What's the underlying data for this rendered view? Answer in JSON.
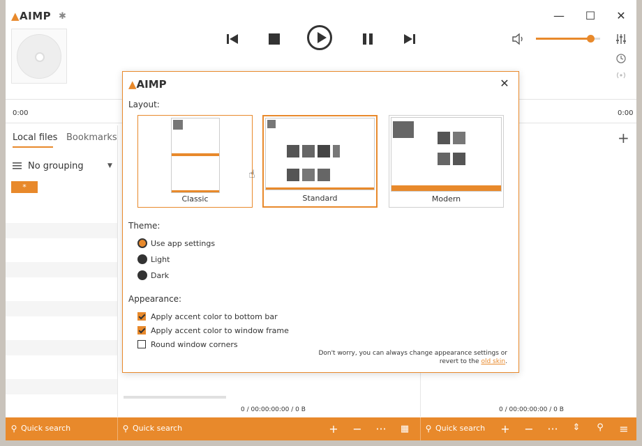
{
  "app": {
    "logo": "AIMP"
  },
  "player": {
    "time_left": "0:00",
    "time_right": "0:00",
    "volume": 0.85
  },
  "tabs": [
    {
      "label": "Local files",
      "active": true
    },
    {
      "label": "Bookmarks",
      "active": false
    }
  ],
  "grouping": {
    "label": "No grouping"
  },
  "filter_badge": "*",
  "status": {
    "middle": "0 / 00:00:00:00 / 0 B",
    "right": "0 / 00:00:00:00 / 0 B"
  },
  "bottombar": {
    "quick_search_1": "Quick search",
    "quick_search_2": "Quick search",
    "quick_search_3": "Quick search"
  },
  "dialog": {
    "logo": "AIMP",
    "layout_title": "Layout:",
    "layouts": [
      {
        "label": "Classic",
        "selected": false
      },
      {
        "label": "Standard",
        "selected": true
      },
      {
        "label": "Modern",
        "selected": false
      }
    ],
    "theme_title": "Theme:",
    "themes": [
      {
        "label": "Use app settings",
        "selected": true
      },
      {
        "label": "Light",
        "selected": false
      },
      {
        "label": "Dark",
        "selected": false
      }
    ],
    "appearance_title": "Appearance:",
    "options": [
      {
        "label": "Apply accent color to bottom bar",
        "checked": true
      },
      {
        "label": "Apply accent color to window frame",
        "checked": true
      },
      {
        "label": "Round window corners",
        "checked": false
      }
    ],
    "note_text": "Don't worry, you can always change appearance settings or revert to the",
    "note_link": "old skin",
    "note_end": "."
  },
  "colors": {
    "accent": "#e8892b",
    "text": "#333333"
  }
}
